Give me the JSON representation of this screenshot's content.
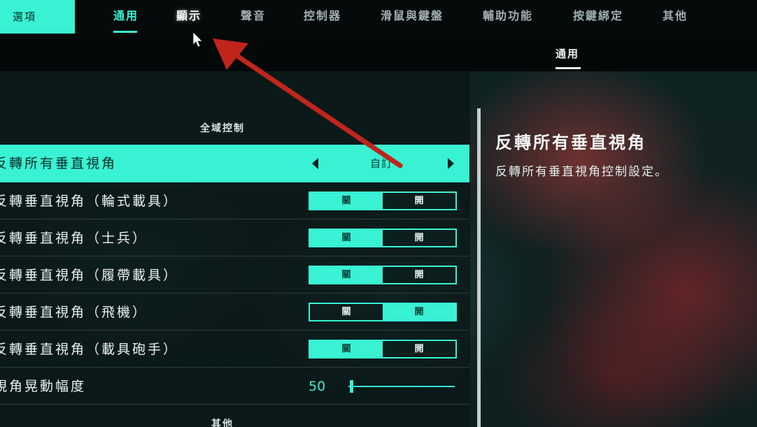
{
  "app": {
    "options_tab": "選項"
  },
  "nav": {
    "tabs": [
      {
        "label": "通用",
        "state": "active"
      },
      {
        "label": "顯示",
        "state": "hover"
      },
      {
        "label": "聲音",
        "state": "normal"
      },
      {
        "label": "控制器",
        "state": "normal"
      },
      {
        "label": "滑鼠與鍵盤",
        "state": "normal"
      },
      {
        "label": "輔助功能",
        "state": "normal"
      },
      {
        "label": "按鍵綁定",
        "state": "normal"
      },
      {
        "label": "其他",
        "state": "normal"
      }
    ],
    "subtab": "通用"
  },
  "settings": {
    "section_global": "全域控制",
    "section_other": "其他",
    "rows": [
      {
        "label": "反轉所有垂直視角",
        "type": "selector",
        "value": "自訂"
      },
      {
        "label": "反轉垂直視角（輪式載具）",
        "type": "toggle",
        "off": "關",
        "on": "開",
        "state": "off"
      },
      {
        "label": "反轉垂直視角（士兵）",
        "type": "toggle",
        "off": "關",
        "on": "開",
        "state": "off"
      },
      {
        "label": "反轉垂直視角（履帶載具）",
        "type": "toggle",
        "off": "關",
        "on": "開",
        "state": "off"
      },
      {
        "label": "反轉垂直視角（飛機）",
        "type": "toggle",
        "off": "關",
        "on": "開",
        "state": "on"
      },
      {
        "label": "反轉垂直視角（載具砲手）",
        "type": "toggle",
        "off": "關",
        "on": "開",
        "state": "off"
      },
      {
        "label": "視角晃動幅度",
        "type": "slider",
        "value": "50",
        "fraction": 0.02
      }
    ]
  },
  "description": {
    "title": "反轉所有垂直視角",
    "text": "反轉所有垂直視角控制設定。"
  },
  "colors": {
    "accent": "#38f2d3",
    "annotation_arrow": "#c0251c"
  }
}
